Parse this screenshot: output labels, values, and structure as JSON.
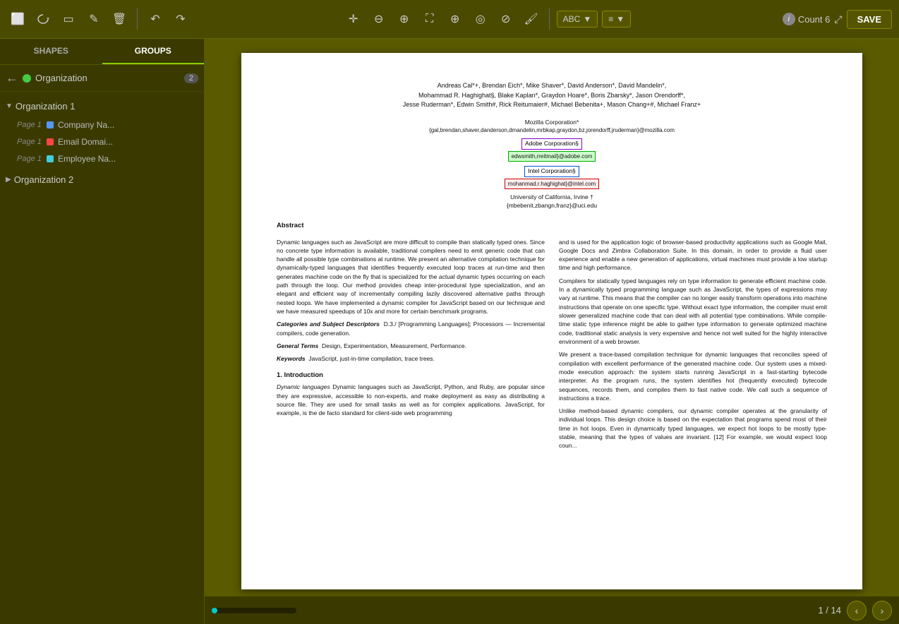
{
  "toolbar": {
    "tools": [
      {
        "name": "selection-tool-icon",
        "symbol": "⬜"
      },
      {
        "name": "lasso-tool-icon",
        "symbol": "△"
      },
      {
        "name": "crop-tool-icon",
        "symbol": "▭"
      },
      {
        "name": "edit-tool-icon",
        "symbol": "✎"
      },
      {
        "name": "delete-tool-icon",
        "symbol": "🗑"
      },
      {
        "name": "undo-icon",
        "symbol": "↶"
      },
      {
        "name": "redo-icon",
        "symbol": "↷"
      }
    ],
    "center_tools": [
      {
        "name": "move-icon",
        "symbol": "✛"
      },
      {
        "name": "zoom-out-icon",
        "symbol": "⊖"
      },
      {
        "name": "zoom-in-icon",
        "symbol": "⊕"
      },
      {
        "name": "fit-icon",
        "symbol": "⛶"
      },
      {
        "name": "add-circle-icon",
        "symbol": "⊕"
      },
      {
        "name": "target-icon",
        "symbol": "◎"
      },
      {
        "name": "clear-icon",
        "symbol": "⊘"
      },
      {
        "name": "brush-icon",
        "symbol": "🖌"
      }
    ],
    "abc_label": "ABC",
    "menu_icon": "≡",
    "count_label": "Count 6",
    "save_label": "SAVE"
  },
  "sidebar": {
    "tabs": [
      {
        "label": "SHAPES",
        "active": false
      },
      {
        "label": "GROUPS",
        "active": true
      }
    ],
    "back_label": "←",
    "org_label": "Organization",
    "org_count": "2",
    "groups": [
      {
        "id": "org1",
        "label": "Organization 1",
        "expanded": true,
        "items": [
          {
            "page": "Page 1",
            "color": "blue",
            "label": "Company Na...",
            "full_label": "Company Name"
          },
          {
            "page": "Page 1",
            "color": "red",
            "label": "Email Domai...",
            "full_label": "Email Domain"
          },
          {
            "page": "Page 1",
            "color": "cyan",
            "label": "Employee Na...",
            "full_label": "Employee Name"
          }
        ]
      },
      {
        "id": "org2",
        "label": "Organization 2",
        "expanded": false,
        "items": []
      }
    ]
  },
  "document": {
    "authors": "Andreas Cal*+, Brendan Eich*, Mike Shaver*, David Anderson*, David Mandelin*,",
    "authors2": "Mohammad R. Haghighat§, Blake Kaplan*, Graydon Hoare*, Boris Zbarsky*, Jason Orendorff*,",
    "authors3": "Jesse Ruderman*, Edwin Smith#, Rick Reitumaier#, Michael Bebenita+, Mason Chang+#, Michael Franz+",
    "affil1_label": "Mozilla Corporation*",
    "affil1_email": "{gal,brendan,shaver,danderson,dmandelin,mrbkap,graydon,bz,jorendorff,jruderman}@mozilla.com",
    "affil2_label": "Adobe Corporation§",
    "affil2_email": "edwsmith,rreitmail}@adobe.com",
    "affil3_label": "Intel Corporation§",
    "affil3_email": "mohanmad.r.haghighat}@intel.com",
    "affil4_label": "University of California, Irvine †",
    "affil4_email": "{mbebenit,zbangn,franz}@uci.edu",
    "abstract_title": "Abstract",
    "abstract_text": "Dynamic languages such as JavaScript are more difficult to compile than statically typed ones. Since no concrete type information is available, traditional compilers need to emit generic code that can handle all possible type combinations at runtime. We present an alternative compilation technique for dynamically-typed languages that identifies frequently executed loop traces at run-time and then generates machine code on the fly that is specialized for the actual dynamic types occurring on each path through the loop. Our method provides cheap inter-procedural type specialization, and an elegant and efficient way of incrementally compiling lazily discovered alternative paths through nested loops. We have implemented a dynamic compiler for JavaScript based on our technique and we have measured speedups of 10x and more for certain benchmark programs.",
    "categories_title": "Categories and Subject Descriptors",
    "categories_text": "D.3./ [Programming Languages]; Processors — Incremental compilers, code generation.",
    "general_terms_title": "General Terms",
    "general_terms_text": "Design, Experimentation, Measurement, Performance.",
    "keywords_title": "Keywords",
    "keywords_text": "JavaScript, just-in-time compilation, trace trees.",
    "section1_title": "1.    Introduction",
    "section1_text": "Dynamic languages such as JavaScript, Python, and Ruby, are popular since they are expressive, accessible to non-experts, and make deployment as easy as distributing a source file. They are used for small tasks as well as for complex applications. JavaScript, for example, is the de facto standard for client-side web programming",
    "right_col_text1": "and is used for the application logic of browser-based productivity applications such as Google Mail, Google Docs and Zimbra Collaboration Suite. In this domain, in order to provide a fluid user experience and enable a new generation of applications, virtual machines must provide a low startup time and high performance.",
    "right_col_text2": "Compilers for statically typed languages rely on type information to generate efficient machine code. In a dynamically typed programming language such as JavaScript, the types of expressions may vary at runtime. This means that the compiler can no longer easily transform operations into machine instructions that operate on one specific type. Without exact type information, the compiler must emit slower generalized machine code that can deal with all potential type combinations. While compile-time static type inference might be able to gather type information to generate optimized machine code, traditional static analysis is very expensive and hence not well suited for the highly interactive environment of a web browser.",
    "right_col_text3": "We present a trace-based compilation technique for dynamic languages that reconciles speed of compilation with excellent performance of the generated machine code. Our system uses a mixed-mode execution approach: the system starts running JavaScript in a fast-starting bytecode interpreter. As the program runs, the system identifies hot (frequently executed) bytecode sequences, records them, and compiles them to fast native code. We call such a sequence of instructions a trace.",
    "right_col_text4": "Unlike method-based dynamic compilers, our dynamic compiler operates at the granularity of individual loops. This design choice is based on the expectation that programs spend most of their time in hot loops. Even in dynamically typed languages, we expect hot loops to be mostly type-stable, meaning that the types of values are invariant. [12] For example, we would expect loop coun..."
  },
  "pagination": {
    "current": "1",
    "total": "14",
    "label": "1 / 14",
    "progress_percent": 7
  }
}
